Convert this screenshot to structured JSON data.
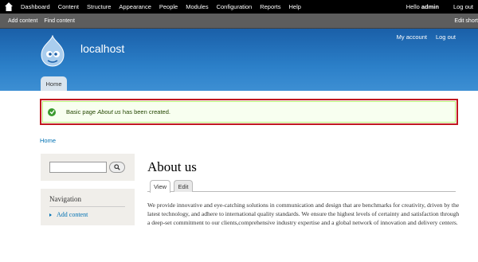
{
  "toolbar": {
    "menu": [
      "Dashboard",
      "Content",
      "Structure",
      "Appearance",
      "People",
      "Modules",
      "Configuration",
      "Reports",
      "Help"
    ],
    "hello": "Hello",
    "username": "admin",
    "logout": "Log out"
  },
  "shortcuts": {
    "links": [
      "Add content",
      "Find content"
    ],
    "edit": "Edit short"
  },
  "header": {
    "site_name": "localhost",
    "secondary_menu": [
      "My account",
      "Log out"
    ],
    "home_tab": "Home"
  },
  "status": {
    "prefix": "Basic page",
    "title": "About us",
    "suffix": "has been created."
  },
  "breadcrumb": "Home",
  "sidebar": {
    "navigation_title": "Navigation",
    "navigation_items": [
      "Add content"
    ]
  },
  "content": {
    "title": "About us",
    "tabs": [
      "View",
      "Edit"
    ],
    "body": "We provide innovative and eye-catching solutions in communication and design that are benchmarks for creativity, driven by the latest technology, and adhere to international quality standards. We ensure the highest levels of certainty and satisfaction through a deep-set commitment to our clients,comprehensive industry expertise and a global network of innovation and delivery centers."
  },
  "colors": {
    "header_blue": "#2b7fc8",
    "toolbar": "#000000",
    "link": "#0071b3",
    "success_bg": "#f8fff0",
    "highlight_red": "#c0181f"
  }
}
